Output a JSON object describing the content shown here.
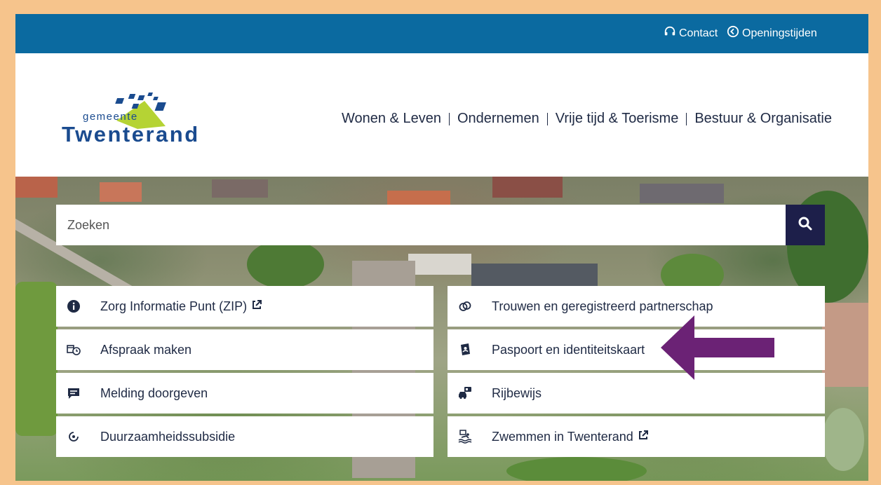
{
  "topbar": {
    "contact_label": "Contact",
    "hours_label": "Openingstijden",
    "background": "#0b6aa0"
  },
  "logo": {
    "line1": "gemeente",
    "line2": "Twenterand"
  },
  "nav": {
    "items": [
      "Wonen & Leven",
      "Ondernemen",
      "Vrije tijd & Toerisme",
      "Bestuur & Organisatie"
    ]
  },
  "search": {
    "placeholder": "Zoeken",
    "button_icon": "search-icon"
  },
  "tiles": {
    "left": [
      {
        "label": "Zorg Informatie Punt (ZIP)",
        "icon": "info-icon",
        "external": true
      },
      {
        "label": "Afspraak maken",
        "icon": "calendar-clock-icon",
        "external": false
      },
      {
        "label": "Melding doorgeven",
        "icon": "message-icon",
        "external": false
      },
      {
        "label": "Duurzaamheidssubsidie",
        "icon": "recycle-icon",
        "external": false
      }
    ],
    "right": [
      {
        "label": "Trouwen en geregistreerd partnerschap",
        "icon": "rings-icon",
        "external": false
      },
      {
        "label": "Paspoort en identiteitskaart",
        "icon": "passport-icon",
        "external": false
      },
      {
        "label": "Rijbewijs",
        "icon": "car-icon",
        "external": false
      },
      {
        "label": "Zwemmen in Twenterand",
        "icon": "swim-icon",
        "external": true
      }
    ]
  },
  "colors": {
    "frame": "#f6c48c",
    "search_button": "#1d1f4a",
    "arrow": "#6b2275",
    "text": "#1f2a44"
  }
}
